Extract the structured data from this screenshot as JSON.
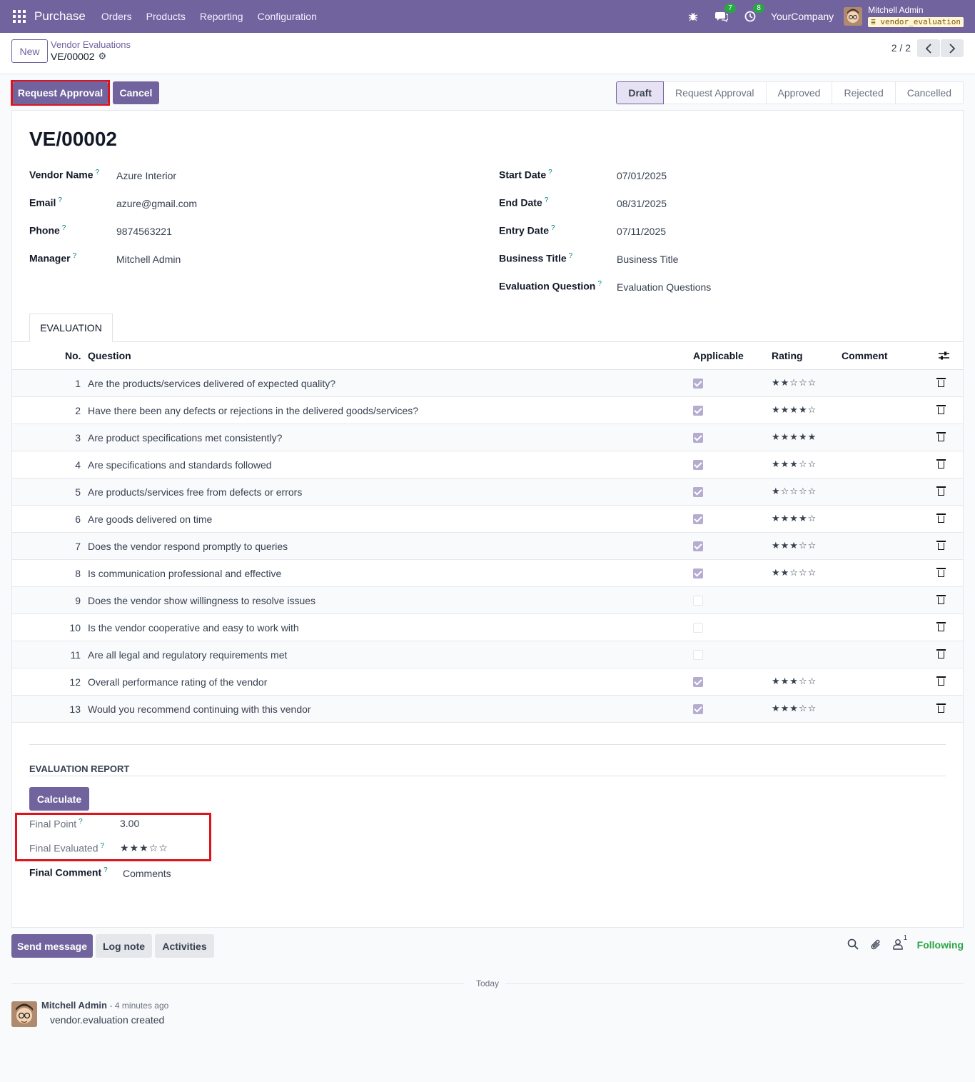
{
  "navbar": {
    "app_name": "Purchase",
    "menu": [
      "Orders",
      "Products",
      "Reporting",
      "Configuration"
    ],
    "messages_count": "7",
    "activities_count": "8",
    "company": "YourCompany",
    "user_name": "Mitchell Admin",
    "database": "vendor_evaluation"
  },
  "control": {
    "new_label": "New",
    "breadcrumb": "Vendor Evaluations",
    "record_name": "VE/00002",
    "pager": "2 / 2"
  },
  "status": {
    "request_approval_label": "Request Approval",
    "cancel_label": "Cancel",
    "stages": [
      "Draft",
      "Request Approval",
      "Approved",
      "Rejected",
      "Cancelled"
    ],
    "active_stage": "Draft"
  },
  "form": {
    "title": "VE/00002",
    "left": [
      {
        "label": "Vendor Name",
        "value": "Azure Interior"
      },
      {
        "label": "Email",
        "value": "azure@gmail.com"
      },
      {
        "label": "Phone",
        "value": "9874563221"
      },
      {
        "label": "Manager",
        "value": "Mitchell Admin"
      }
    ],
    "right": [
      {
        "label": "Start Date",
        "value": "07/01/2025"
      },
      {
        "label": "End Date",
        "value": "08/31/2025"
      },
      {
        "label": "Entry Date",
        "value": "07/11/2025"
      },
      {
        "label": "Business Title",
        "value": "Business Title"
      },
      {
        "label": "Evaluation Question",
        "value": "Evaluation Questions"
      }
    ],
    "help_mark": "?"
  },
  "evaluation": {
    "tab_label": "EVALUATION",
    "columns": {
      "no": "No.",
      "question": "Question",
      "applicable": "Applicable",
      "rating": "Rating",
      "comment": "Comment"
    },
    "rows": [
      {
        "no": "1",
        "question": "Are the products/services delivered of expected quality?",
        "applicable": true,
        "rating": 2
      },
      {
        "no": "2",
        "question": "Have there been any defects or rejections in the delivered goods/services?",
        "applicable": true,
        "rating": 4
      },
      {
        "no": "3",
        "question": "Are product specifications met consistently?",
        "applicable": true,
        "rating": 5
      },
      {
        "no": "4",
        "question": "Are specifications and standards followed",
        "applicable": true,
        "rating": 3
      },
      {
        "no": "5",
        "question": "Are products/services free from defects or errors",
        "applicable": true,
        "rating": 1
      },
      {
        "no": "6",
        "question": "Are goods delivered on time",
        "applicable": true,
        "rating": 4
      },
      {
        "no": "7",
        "question": "Does the vendor respond promptly to queries",
        "applicable": true,
        "rating": 3
      },
      {
        "no": "8",
        "question": "Is communication professional and effective",
        "applicable": true,
        "rating": 2
      },
      {
        "no": "9",
        "question": "Does the vendor show willingness to resolve issues",
        "applicable": false,
        "rating": 0
      },
      {
        "no": "10",
        "question": "Is the vendor cooperative and easy to work with",
        "applicable": false,
        "rating": 0
      },
      {
        "no": "11",
        "question": "Are all legal and regulatory requirements met",
        "applicable": false,
        "rating": 0
      },
      {
        "no": "12",
        "question": "Overall performance rating of the vendor",
        "applicable": true,
        "rating": 3
      },
      {
        "no": "13",
        "question": "Would you recommend continuing with this vendor",
        "applicable": true,
        "rating": 3
      }
    ]
  },
  "report": {
    "section_title": "EVALUATION REPORT",
    "calculate_label": "Calculate",
    "final_point_label": "Final Point",
    "final_point_value": "3.00",
    "final_evaluated_label": "Final Evaluated",
    "final_evaluated_rating": 3,
    "final_comment_label": "Final Comment",
    "final_comment_value": "Comments"
  },
  "chatter": {
    "send_message_label": "Send message",
    "log_note_label": "Log note",
    "activities_label": "Activities",
    "followers_count": "1",
    "following_label": "Following",
    "today_label": "Today",
    "message_author": "Mitchell Admin",
    "message_time": "- 4 minutes ago",
    "message_body": "vendor.evaluation created"
  },
  "colors": {
    "brand": "#71639e",
    "highlight": "#e0121b",
    "following": "#28a745"
  }
}
